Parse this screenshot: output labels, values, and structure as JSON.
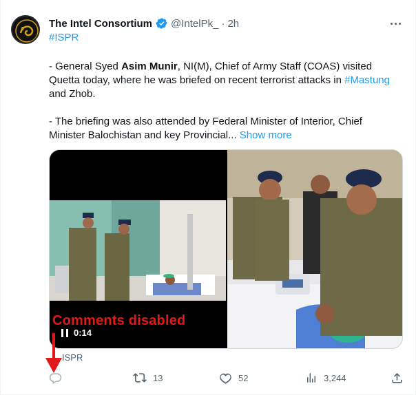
{
  "author": {
    "display_name": "The Intel Consortium",
    "handle": "@IntelPk_",
    "separator": "·",
    "time": "2h"
  },
  "hashtag_top": "#ISPR",
  "body": {
    "p1_prefix": "- General Syed ",
    "p1_bold": "Asim Munir",
    "p1_mid": ", NI(M), Chief of Army Staff (COAS) visited Quetta today, where he was briefed on recent terrorist attacks in ",
    "p1_link": "#Mastung",
    "p1_suffix": " and Zhob.",
    "p2": "- The briefing was also attended by Federal Minister of Interior, Chief Minister Balochistan and key Provincial...",
    "show_more": "Show more"
  },
  "video": {
    "time": "0:14"
  },
  "annotation": "Comments disabled",
  "media_caption": "ISPR",
  "actions": {
    "reply_count": "",
    "retweet_count": "13",
    "like_count": "52",
    "views_count": "3,244"
  },
  "colors": {
    "link": "#1d9bf0",
    "muted": "#536471",
    "annotation": "#e01a1a"
  }
}
